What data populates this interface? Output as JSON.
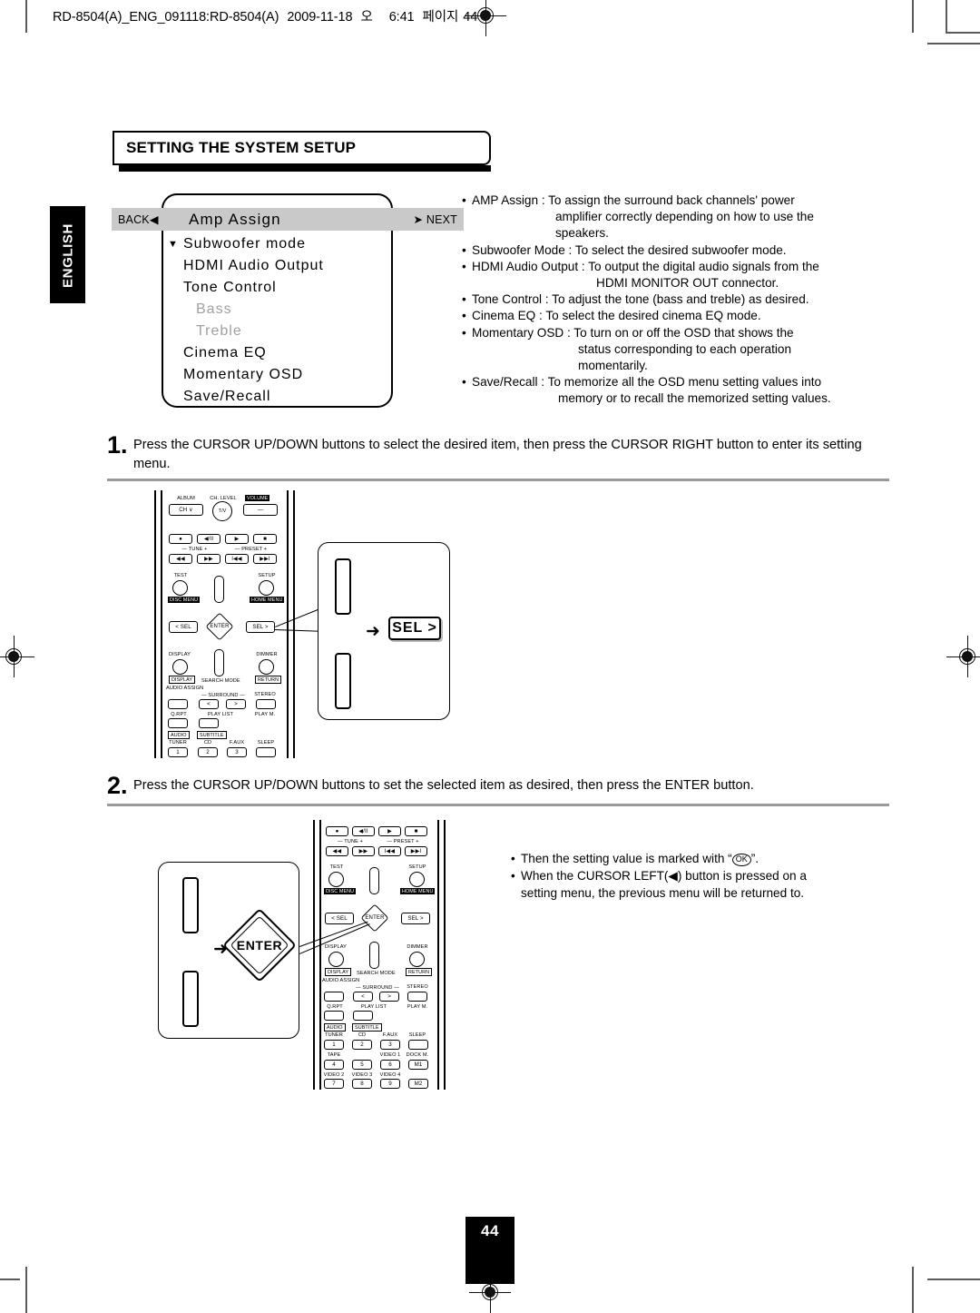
{
  "header": {
    "file_ref": "RD-8504(A)_ENG_091118:RD-8504(A)",
    "date": "2009-11-18",
    "ampm": "오",
    "time": "6:41",
    "page_label": "페이지",
    "page_number": "44"
  },
  "sidebar": {
    "language_tab": "ENGLISH"
  },
  "title": "SETTING THE SYSTEM SETUP",
  "osd": {
    "back_label": "BACK",
    "back_arrow": "◀",
    "next_arrow": "➤",
    "next_label": "NEXT",
    "selected_title": "Amp Assign",
    "caret": "▼",
    "items": [
      {
        "label": "Subwoofer mode",
        "dim": false,
        "caret": true
      },
      {
        "label": "HDMI Audio Output",
        "dim": false,
        "caret": false
      },
      {
        "label": "Tone Control",
        "dim": false,
        "caret": false
      },
      {
        "label": "Bass",
        "dim": true,
        "caret": false
      },
      {
        "label": "Treble",
        "dim": true,
        "caret": false
      },
      {
        "label": "Cinema EQ",
        "dim": false,
        "caret": false
      },
      {
        "label": "Momentary OSD",
        "dim": false,
        "caret": false
      },
      {
        "label": "Save/Recall",
        "dim": false,
        "caret": false
      }
    ]
  },
  "bullets": [
    {
      "lines": [
        "AMP Assign : To assign the surround back channels' power",
        "amplifier correctly depending on how to use the",
        "speakers."
      ],
      "indents": [
        0,
        92,
        92
      ]
    },
    {
      "lines": [
        "Subwoofer Mode : To select the desired subwoofer mode."
      ],
      "indents": [
        0
      ]
    },
    {
      "lines": [
        "HDMI Audio Output : To output the digital audio signals from the",
        "HDMI MONITOR OUT connector."
      ],
      "indents": [
        0,
        137
      ]
    },
    {
      "lines": [
        "Tone Control : To adjust the tone (bass and treble) as desired."
      ],
      "indents": [
        0
      ]
    },
    {
      "lines": [
        "Cinema EQ : To select the desired cinema EQ mode."
      ],
      "indents": [
        0
      ]
    },
    {
      "lines": [
        "Momentary OSD : To turn on or off the OSD that shows the",
        "status corresponding to each operation",
        "momentarily."
      ],
      "indents": [
        0,
        118,
        118
      ]
    },
    {
      "lines": [
        "Save/Recall : To memorize all the OSD menu setting values into",
        "memory or to recall the memorized setting values."
      ],
      "indents": [
        0,
        95
      ]
    }
  ],
  "steps": [
    {
      "number": "1.",
      "text": "Press the CURSOR UP/DOWN buttons to select the desired item, then press the CURSOR RIGHT button to enter its setting menu."
    },
    {
      "number": "2.",
      "text": "Press the CURSOR UP/DOWN buttons to set the selected item as desired, then press the ENTER button."
    }
  ],
  "callouts": {
    "step1_button": "SEL >",
    "step2_button": "ENTER",
    "arrow": "➜"
  },
  "notes": [
    {
      "lines": [
        "Then the setting value is marked with “",
        "”."
      ],
      "glyph": "OK"
    },
    {
      "lines": [
        "When the CURSOR LEFT(◀) button is pressed on a",
        "setting menu, the previous menu will be returned to."
      ]
    }
  ],
  "remote": {
    "top_labels": {
      "album": "ALBUM",
      "ch_level": "CH. LEVEL",
      "volume": "VOLUME"
    },
    "ch_button": "CH ∨",
    "tv_knob": "T/V",
    "volume_button": "—",
    "transport": [
      "●",
      "◀/II",
      "▶",
      "■"
    ],
    "tune_label": "—  TUNE  +",
    "preset_label": "—  PRESET  +",
    "skip": [
      "◀◀",
      "▶▶",
      "I◀◀",
      "▶▶I"
    ],
    "test": "TEST",
    "setup": "SETUP",
    "disc_menu": "DISC MENU",
    "home_menu": "HOME MENU",
    "sel_left": "< SEL",
    "enter": "ENTER",
    "sel_right": "SEL >",
    "display": "DISPLAY",
    "dimmer": "DIMMER",
    "display_box": "DISPLAY",
    "return_box": "RETURN",
    "search_mode": "SEARCH MODE",
    "audio_assign": "AUDIO ASSIGN",
    "surround": "—  SURROUND  —",
    "stereo": "STEREO",
    "surr_left": "<",
    "surr_right": ">",
    "q_rpt": "Q.RPT",
    "play_list": "PLAY LIST",
    "play_m": "PLAY M.",
    "audio_box": "AUDIO",
    "subtitle_box": "SUBTITLE",
    "num_labels_row1": [
      "TUNER",
      "CD",
      "F.AUX",
      "SLEEP"
    ],
    "num_row1": [
      "1",
      "2",
      "3",
      ""
    ],
    "num_labels_row2": [
      "TAPE",
      "",
      "VIDEO 1",
      "DOCK M."
    ],
    "num_row2": [
      "4",
      "5",
      "6",
      "M1"
    ],
    "num_labels_row3": [
      "VIDEO 2",
      "VIDEO 3",
      "VIDEO 4",
      ""
    ],
    "num_row3": [
      "7",
      "8",
      "9",
      "M2"
    ]
  },
  "colors": {
    "osd_bar": "#c9c9c9",
    "dim_text": "#a0a0a0",
    "rule": "#9a9a9a",
    "black": "#000000"
  }
}
